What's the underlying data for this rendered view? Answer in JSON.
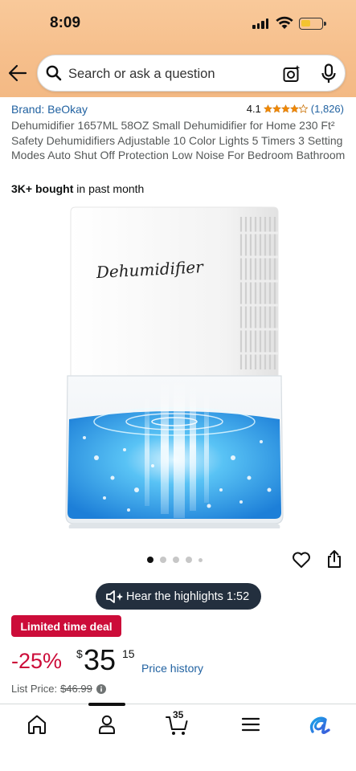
{
  "status_bar": {
    "time": "8:09"
  },
  "search": {
    "placeholder": "Search or ask a question"
  },
  "product": {
    "brand": "Brand: BeOkay",
    "rating": "4.1",
    "rating_value": 4.1,
    "rating_count": "(1,826)",
    "title": "Dehumidifier 1657ML 58OZ Small Dehumidifier for Home 230 Ft² Safety Dehumidifiers Adjustable 10 Color Lights 5 Timers 3 Setting Modes Auto Shut Off Protection Low Noise For Bedroom Bathroom",
    "bought_bold": "3K+ bought",
    "bought_rest": " in past month",
    "image_label": "Dehumidifier"
  },
  "carousel": {
    "dots": 5,
    "active": 0
  },
  "highlights": {
    "label": "Hear the highlights",
    "duration": "1:52"
  },
  "deal": {
    "badge": "Limited time deal"
  },
  "price": {
    "discount": "-25%",
    "symbol": "$",
    "whole": "35",
    "fraction": "15",
    "history_link": "Price history",
    "list_label": "List Price:",
    "list_value": "$46.99"
  },
  "bottom_nav": {
    "cart_count": "35"
  },
  "colors": {
    "header_bg": "#f6bf8c",
    "link": "#2162a1",
    "deal_red": "#cc0c39",
    "star": "#f08804",
    "dark_pill": "#232f3e"
  }
}
